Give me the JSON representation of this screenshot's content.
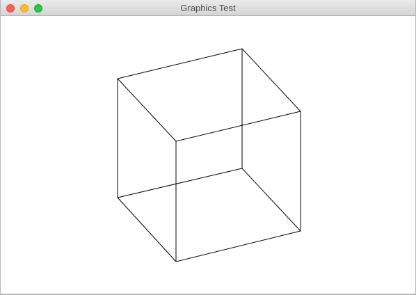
{
  "window": {
    "title": "Graphics Test"
  },
  "controls": {
    "close_icon": "close-icon",
    "minimize_icon": "minimize-icon",
    "zoom_icon": "zoom-icon",
    "close_color": "#fc5f57",
    "minimize_color": "#fdbc2e",
    "zoom_color": "#28c840"
  },
  "drawing": {
    "shape": "wireframe cube",
    "stroke_color": "#000000",
    "background_color": "#ffffff"
  }
}
